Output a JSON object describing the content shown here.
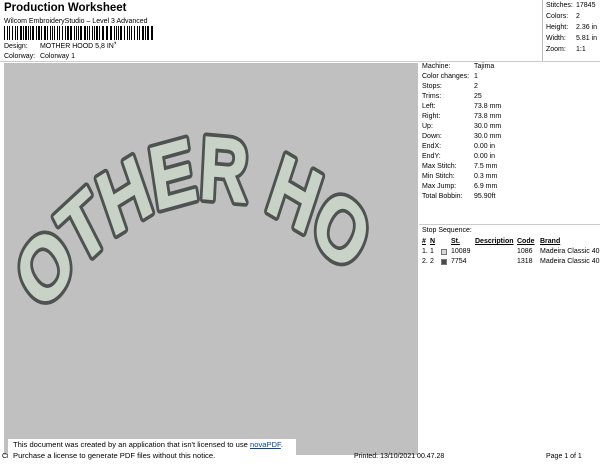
{
  "header": {
    "title": "Production Worksheet",
    "subtitle": "Wilcom EmbroideryStudio – Level 3 Advanced",
    "design_label": "Design:",
    "design_value": "MOTHER HOOD 5,8 IN",
    "colorway_label": "Colorway:",
    "colorway_value": "Colorway 1"
  },
  "stats": [
    {
      "label": "Stitches:",
      "value": "17845"
    },
    {
      "label": "Colors:",
      "value": "2"
    },
    {
      "label": "Height:",
      "value": "2.36 in"
    },
    {
      "label": "Width:",
      "value": "5.81 in"
    },
    {
      "label": "Zoom:",
      "value": "1:1"
    }
  ],
  "artwork": {
    "text": "MOTHER HOOD",
    "fill_color": "#c8d2c6",
    "outline_color": "#4e5352",
    "background": "#c0c0c0"
  },
  "details": [
    {
      "label": "Machine:",
      "value": "Tajima"
    },
    {
      "label": "Color changes:",
      "value": "1"
    },
    {
      "label": "Stops:",
      "value": "2"
    },
    {
      "label": "Trims:",
      "value": "25"
    },
    {
      "label": "Left:",
      "value": "73.8 mm"
    },
    {
      "label": "Right:",
      "value": "73.8 mm"
    },
    {
      "label": "Up:",
      "value": "30.0 mm"
    },
    {
      "label": "Down:",
      "value": "30.0 mm"
    },
    {
      "label": "EndX:",
      "value": "0.00 in"
    },
    {
      "label": "EndY:",
      "value": "0.00 in"
    },
    {
      "label": "Max Stitch:",
      "value": "7.5 mm"
    },
    {
      "label": "Min Stitch:",
      "value": "0.3 mm"
    },
    {
      "label": "Max Jump:",
      "value": "6.9 mm"
    },
    {
      "label": "Total Bobbin:",
      "value": "95.90ft"
    }
  ],
  "stop_sequence": {
    "title": "Stop Sequence:",
    "headers": [
      "#",
      "N",
      "St.",
      "Description",
      "Code",
      "Brand"
    ],
    "rows": [
      {
        "num": "1.",
        "color": "1",
        "swatch": "#d8d8d8",
        "stitches": "10089",
        "description": "",
        "code": "1086",
        "brand": "Madeira Classic 40"
      },
      {
        "num": "2.",
        "color": "2",
        "swatch": "#4a4a4a",
        "stitches": "7754",
        "description": "",
        "code": "1318",
        "brand": "Madeira Classic 40"
      }
    ]
  },
  "footer": {
    "notice_line1_pre": "This document was created by an application that isn't licensed to use ",
    "notice_link": "novaPDF",
    "notice_line1_post": ".",
    "notice_line2": "Purchase a license to generate PDF files without this notice.",
    "cr": "Cr",
    "printed": "Printed: 13/10/2021 00.47.28",
    "page": "Page 1 of 1"
  }
}
